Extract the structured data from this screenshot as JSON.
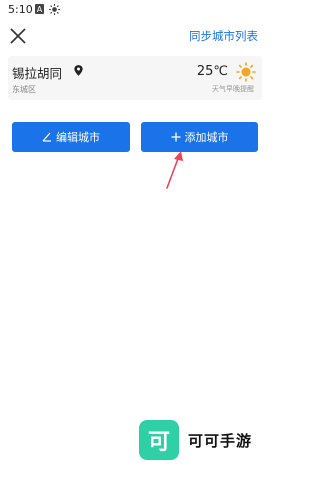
{
  "status_bar": {
    "time": "5:10"
  },
  "header": {
    "sync_label": "同步城市列表"
  },
  "city": {
    "name": "锡拉胡同",
    "district": "东城区",
    "temperature": "25℃",
    "reminder": "天气早晚提醒"
  },
  "actions": {
    "edit_label": "编辑城市",
    "add_label": "添加城市"
  },
  "watermark": {
    "logo_char": "可",
    "name": "可可手游"
  },
  "colors": {
    "accent": "#1a73e8",
    "sun": "#f5a623",
    "arrow": "#e8455a",
    "logo_bg": "#2fd0a5"
  }
}
